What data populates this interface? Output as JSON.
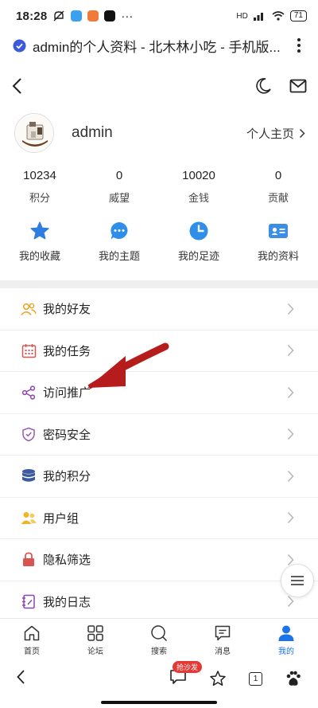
{
  "status_bar": {
    "time": "18:28",
    "more": "···",
    "battery": "71",
    "network": "HD"
  },
  "browser": {
    "title": "admin的个人资料 - 北木林小吃 - 手机版..."
  },
  "profile": {
    "username": "admin",
    "home_link": "个人主页"
  },
  "stats": [
    {
      "value": "10234",
      "label": "积分"
    },
    {
      "value": "0",
      "label": "威望"
    },
    {
      "value": "10020",
      "label": "金钱"
    },
    {
      "value": "0",
      "label": "贡献"
    }
  ],
  "quick_actions": [
    {
      "label": "我的收藏",
      "icon": "star-icon",
      "color": "#2f7de1"
    },
    {
      "label": "我的主题",
      "icon": "chat-bubble-icon",
      "color": "#2f8fe8"
    },
    {
      "label": "我的足迹",
      "icon": "clock-pie-icon",
      "color": "#2f8fe8"
    },
    {
      "label": "我的资料",
      "icon": "id-card-icon",
      "color": "#3a8ee6"
    }
  ],
  "menu": [
    {
      "label": "我的好友",
      "icon": "friends-icon",
      "color": "#f0a020"
    },
    {
      "label": "我的任务",
      "icon": "calendar-icon",
      "color": "#d9534f"
    },
    {
      "label": "访问推广",
      "icon": "share-icon",
      "color": "#8e44ad"
    },
    {
      "label": "密码安全",
      "icon": "shield-icon",
      "color": "#9b59b6"
    },
    {
      "label": "我的积分",
      "icon": "database-icon",
      "color": "#3d5a9e"
    },
    {
      "label": "用户组",
      "icon": "user-group-icon",
      "color": "#f0b429"
    },
    {
      "label": "隐私筛选",
      "icon": "lock-icon",
      "color": "#d9534f"
    },
    {
      "label": "我的日志",
      "icon": "notebook-icon",
      "color": "#8e44ad"
    }
  ],
  "tabbar": [
    {
      "label": "首页",
      "icon": "home-icon",
      "active": false
    },
    {
      "label": "论坛",
      "icon": "grid-icon",
      "active": false
    },
    {
      "label": "搜索",
      "icon": "search-icon",
      "active": false
    },
    {
      "label": "消息",
      "icon": "message-icon",
      "active": false
    },
    {
      "label": "我的",
      "icon": "person-icon",
      "active": true
    }
  ],
  "browser_bottom": {
    "comment_badge": "抢沙发",
    "tab_count": "1"
  },
  "colors": {
    "accent": "#1a73e8",
    "arrow": "#b71c1c"
  }
}
